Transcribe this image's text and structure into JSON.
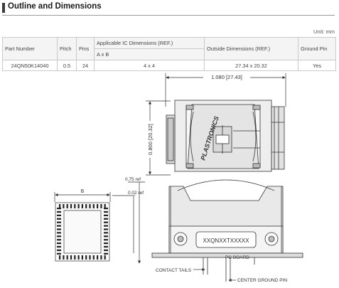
{
  "section": {
    "title": "Outline and Dimensions",
    "unit": "Unit: mm"
  },
  "table": {
    "headers": {
      "part_number": "Part Number",
      "pitch": "Pitch",
      "pins": "Pins",
      "ic_dims": "Applicable IC Dimensions (REF.)",
      "ic_sub": "A x B",
      "outside": "Outside Dimensions (REF.)",
      "ground_pin": "Ground Pin"
    },
    "rows": [
      {
        "part_number": "24QN50K14040",
        "pitch": "0.5",
        "pins": "24",
        "ic_dims": "4 x 4",
        "outside": "27.34 x 20.32",
        "ground_pin": "Yes"
      }
    ]
  },
  "drawing": {
    "dim_width": "1.080  [27.43]",
    "dim_height": "0.800  [20.32]",
    "dim_075": "0.75 ref",
    "dim_002": "0.02 ref",
    "dim_B": "B",
    "label_xx": "XXQNXXTXXXXX",
    "label_pcb": "PC BOARD",
    "label_contact": "CONTACT TAILS",
    "label_ground": "CENTER GROUND PIN",
    "lid_text": "PLASTRONICS"
  }
}
